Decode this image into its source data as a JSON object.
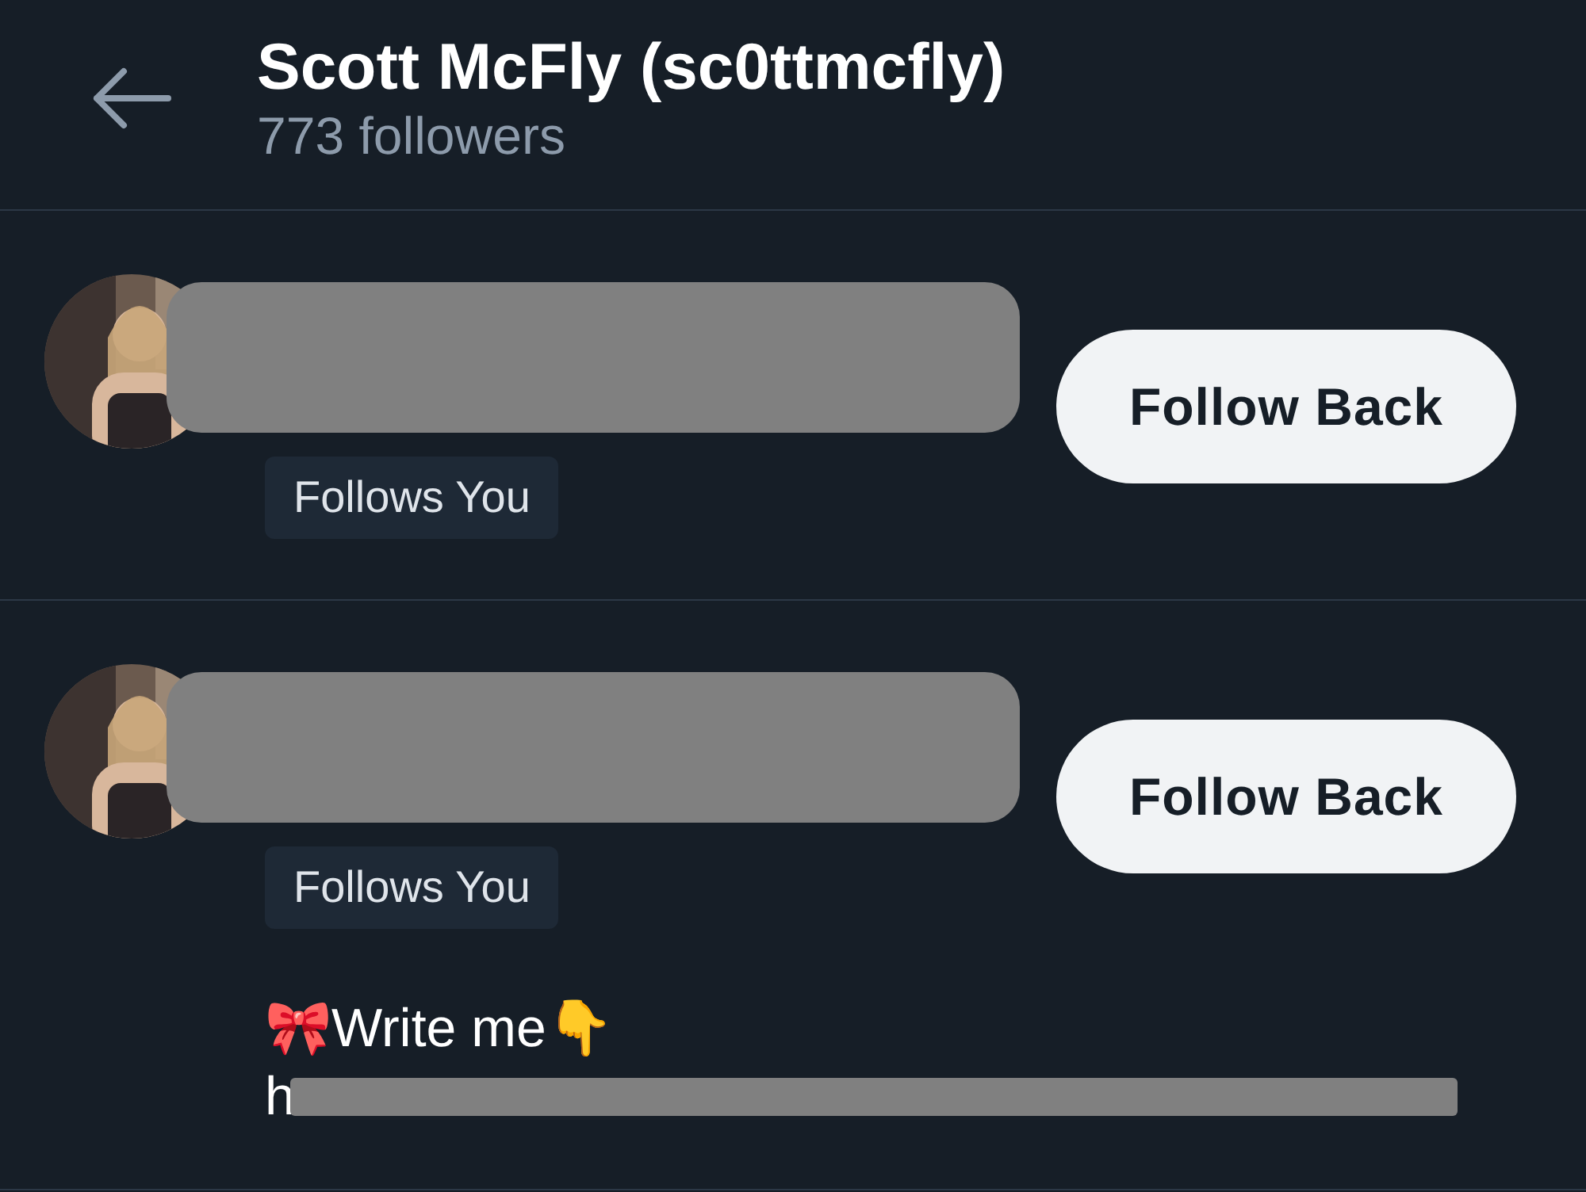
{
  "header": {
    "title": "Scott McFly (sc0ttmcfly)",
    "subtitle": "773 followers"
  },
  "followers": [
    {
      "badge": "Follows You",
      "button": "Follow Back"
    },
    {
      "badge": "Follows You",
      "button": "Follow Back",
      "bio": "🎀Write me👇",
      "link": "h"
    }
  ]
}
